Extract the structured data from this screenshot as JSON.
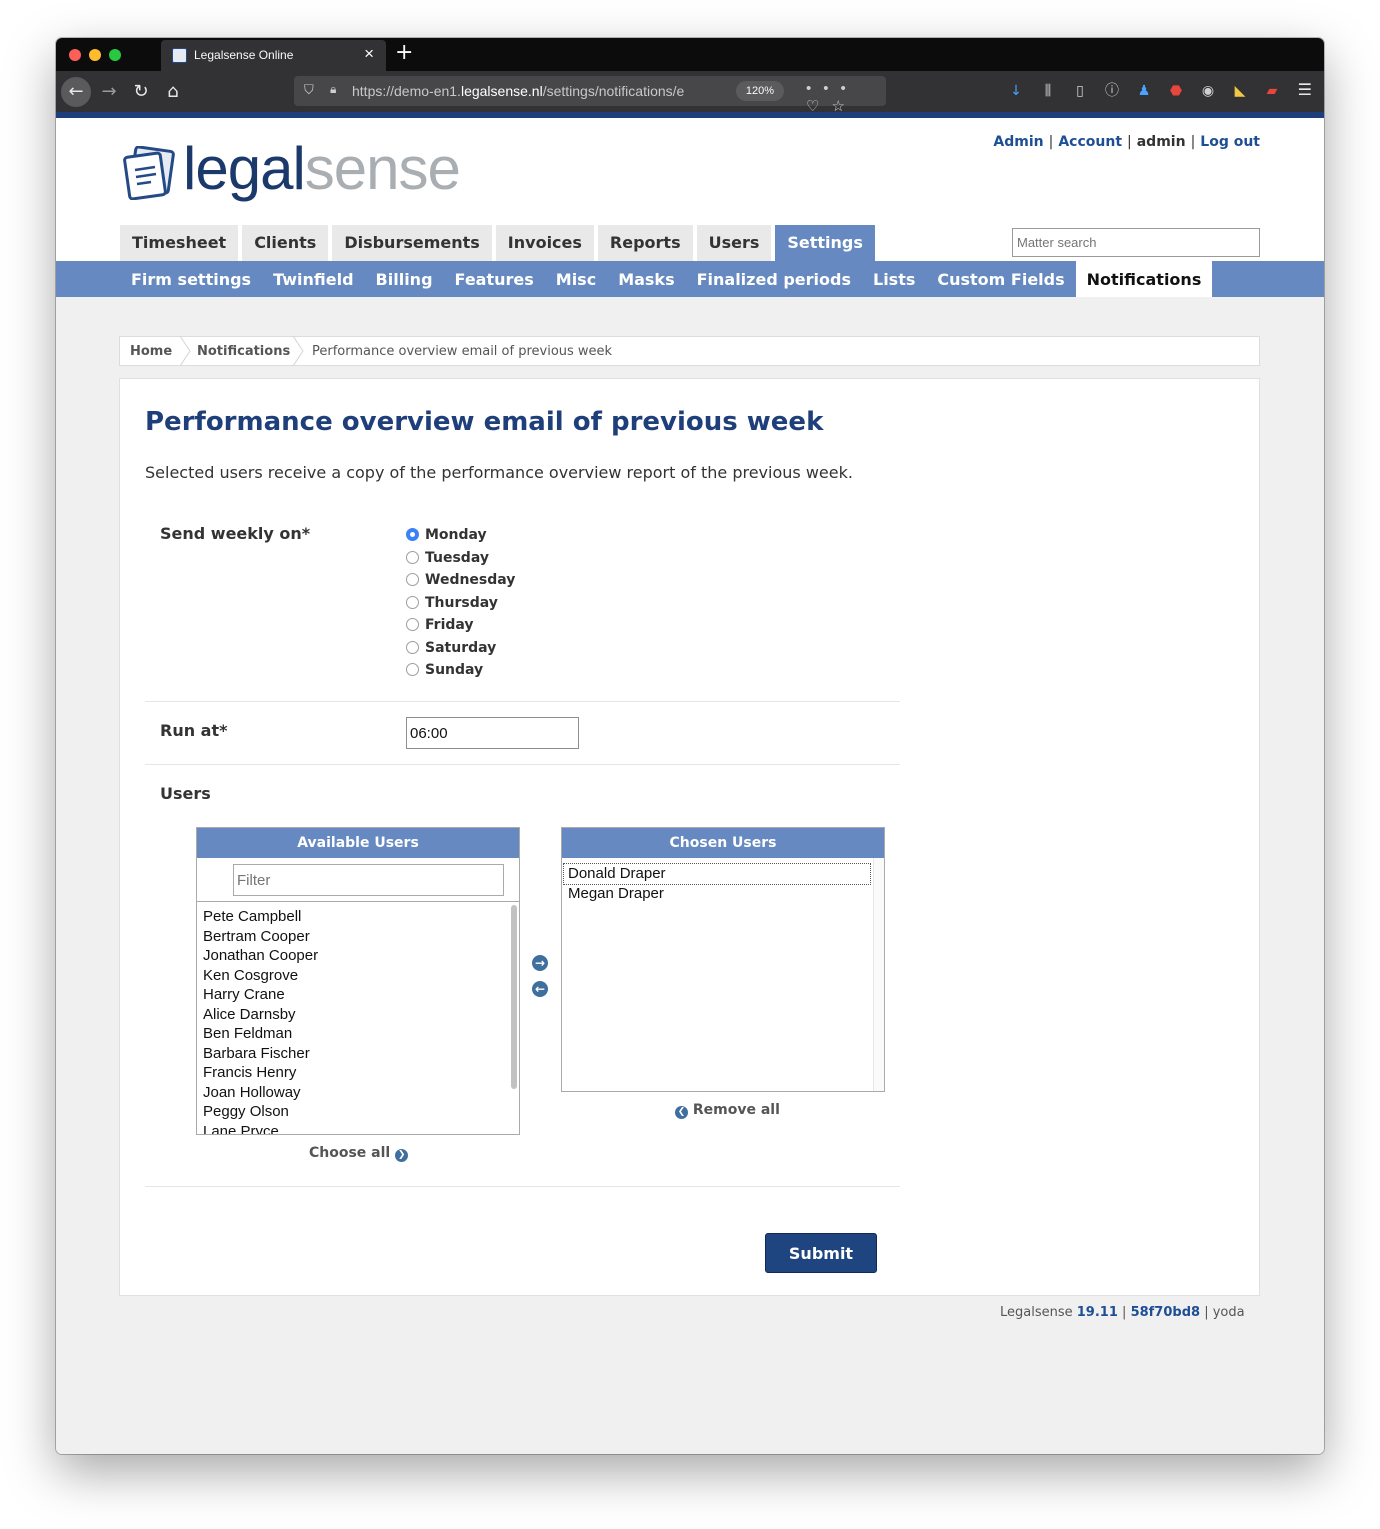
{
  "browser": {
    "tab_title": "Legalsense Online",
    "url_prefix": "https://demo-en1.",
    "url_host": "legalsense.nl",
    "url_path": "/settings/notifications/e",
    "zoom": "120%"
  },
  "header": {
    "logo_legal": "legal",
    "logo_sense": "sense",
    "links": {
      "admin": "Admin",
      "account": "Account",
      "user": "admin",
      "logout": "Log out",
      "separator": "|"
    },
    "search_placeholder": "Matter search"
  },
  "main_tabs": [
    "Timesheet",
    "Clients",
    "Disbursements",
    "Invoices",
    "Reports",
    "Users",
    "Settings"
  ],
  "sub_tabs": [
    "Firm settings",
    "Twinfield",
    "Billing",
    "Features",
    "Misc",
    "Masks",
    "Finalized periods",
    "Lists",
    "Custom Fields",
    "Notifications"
  ],
  "breadcrumb": {
    "home": "Home",
    "notifications": "Notifications",
    "current": "Performance overview email of previous week"
  },
  "page": {
    "title": "Performance overview email of previous week",
    "description": "Selected users receive a copy of the performance overview report of the previous week."
  },
  "form": {
    "send_weekly_label": "Send weekly on*",
    "days": [
      "Monday",
      "Tuesday",
      "Wednesday",
      "Thursday",
      "Friday",
      "Saturday",
      "Sunday"
    ],
    "selected_day": "Monday",
    "run_at_label": "Run at*",
    "run_at_value": "06:00",
    "users_label": "Users",
    "available_header": "Available Users",
    "filter_placeholder": "Filter",
    "available_users": [
      "Pete Campbell",
      "Bertram Cooper",
      "Jonathan Cooper",
      "Ken Cosgrove",
      "Harry Crane",
      "Alice Darnsby",
      "Ben Feldman",
      "Barbara Fischer",
      "Francis Henry",
      "Joan Holloway",
      "Peggy Olson",
      "Lane Pryce"
    ],
    "chosen_header": "Chosen Users",
    "chosen_users": [
      "Donald Draper",
      "Megan Draper"
    ],
    "choose_all": "Choose all",
    "remove_all": "Remove all",
    "submit": "Submit"
  },
  "footer": {
    "app": "Legalsense",
    "version": "19.11",
    "commit": "58f70bd8",
    "host": "yoda",
    "separator": "|"
  },
  "colors": {
    "brand_dark": "#1e3f7a",
    "nav_blue": "#6589c0",
    "link_blue": "#1e4f94"
  }
}
